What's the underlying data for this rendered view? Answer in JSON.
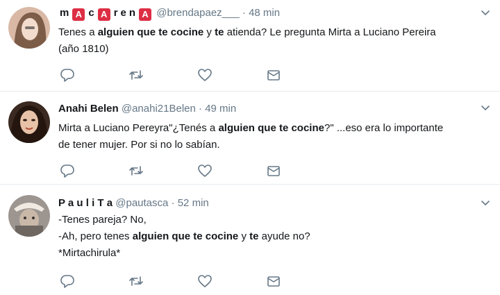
{
  "tweets": [
    {
      "name_letters": [
        "m",
        "A",
        "c",
        "A",
        "r",
        "e",
        "n",
        "A"
      ],
      "handle": "@brendapaez___",
      "separator": "·",
      "time": "48 min",
      "text": {
        "l1_a": "Tenes a ",
        "l1_b": "alguien que te cocine",
        "l1_c": " y ",
        "l1_d": "te",
        "l1_e": " atienda? Le pregunta Mirta a Luciano Pereira",
        "l2": "(año 1810)"
      },
      "avatar_icon": "profile-photo"
    },
    {
      "display_name": "Anahi Belen",
      "handle": "@anahi21Belen",
      "separator": "·",
      "time": "49 min",
      "text": {
        "l1_a": "Mirta a Luciano Pereyra\"¿Tenés a ",
        "l1_b": "alguien que te cocine",
        "l1_c": "?\" ...eso era lo importante",
        "l2": "de tener mujer. Por si no lo sabían."
      },
      "avatar_icon": "profile-photo"
    },
    {
      "display_name": "P a u l i T a",
      "handle": "@pautasca",
      "separator": "·",
      "time": "52 min",
      "text": {
        "l1": "-Tenes pareja? No,",
        "l2_a": "-Ah, pero tenes ",
        "l2_b": "alguien que te cocine",
        "l2_c": " y ",
        "l2_d": "te",
        "l2_e": " ayude no?",
        "l3": "*Mirtachirula*"
      },
      "avatar_icon": "profile-photo"
    }
  ],
  "icons": {
    "reply": "reply-icon",
    "retweet": "retweet-icon",
    "like": "heart-icon",
    "message": "envelope-icon",
    "menu": "chevron-down-icon"
  },
  "colors": {
    "icon_gray": "#657786",
    "badge_red": "#dd2e44",
    "divider": "#e6ecf0"
  }
}
